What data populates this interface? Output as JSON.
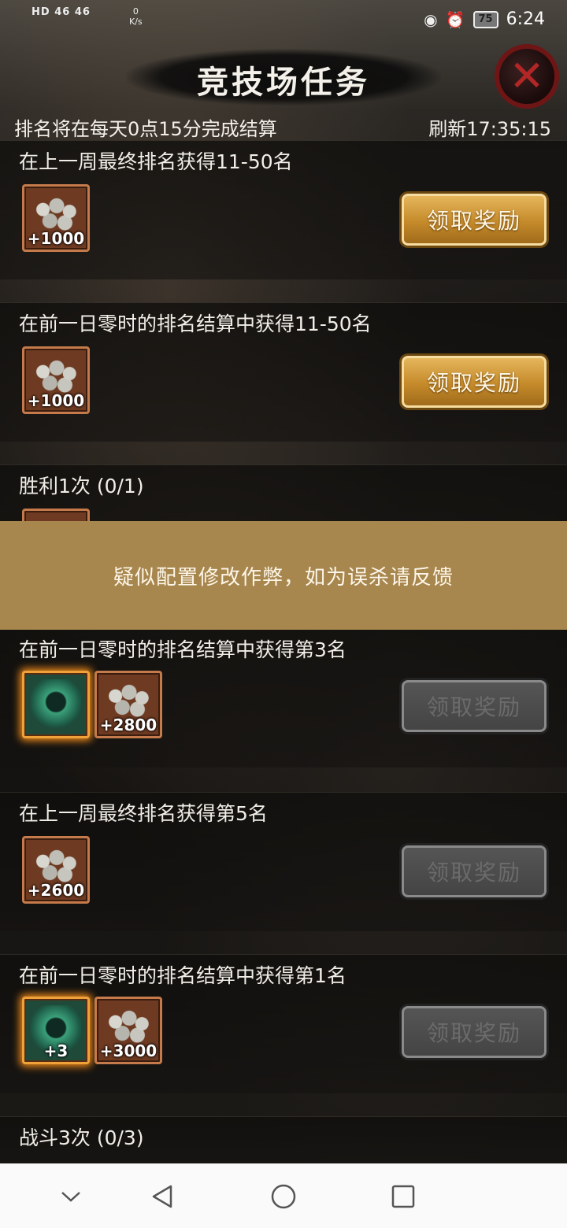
{
  "status_bar": {
    "sim_label": "HD 46 46",
    "net_speed_value": "0",
    "net_speed_unit": "K/s",
    "battery": "75",
    "time": "6:24"
  },
  "header": {
    "title": "竞技场任务",
    "settle_notice": "排名将在每天0点15分完成结算",
    "refresh": "刷新17:35:15"
  },
  "tasks": [
    {
      "title": "在上一周最终排名获得11-50名",
      "rewards": [
        {
          "type": "coins",
          "qty": "+1000"
        }
      ],
      "button": "领取奖励",
      "state": "active"
    },
    {
      "title": "在前一日零时的排名结算中获得11-50名",
      "rewards": [
        {
          "type": "coins",
          "qty": "+1000"
        }
      ],
      "button": "领取奖励",
      "state": "active"
    },
    {
      "title": "胜利1次 (0/1)",
      "rewards": [],
      "button": "",
      "state": "hidden"
    },
    {
      "title": "在前一日零时的排名结算中获得第3名",
      "rewards": [
        {
          "type": "hero",
          "qty": ""
        },
        {
          "type": "coins",
          "qty": "+2800"
        }
      ],
      "button": "领取奖励",
      "state": "disabled"
    },
    {
      "title": "在上一周最终排名获得第5名",
      "rewards": [
        {
          "type": "coins",
          "qty": "+2600"
        }
      ],
      "button": "领取奖励",
      "state": "disabled"
    },
    {
      "title": "在前一日零时的排名结算中获得第1名",
      "rewards": [
        {
          "type": "hero",
          "qty": "+3"
        },
        {
          "type": "coins",
          "qty": "+3000"
        }
      ],
      "button": "领取奖励",
      "state": "disabled"
    },
    {
      "title": "战斗3次 (0/3)",
      "rewards": [],
      "button": "",
      "state": "hidden"
    }
  ],
  "toast": "疑似配置修改作弊，如为误杀请反馈",
  "nav": {
    "icons": [
      "chevron-down-icon",
      "back-icon",
      "home-icon",
      "recents-icon"
    ]
  },
  "colors": {
    "toast_bg": "#a8874f",
    "button_gold": "#c58a2a",
    "button_disabled": "#4a4a4a",
    "close_red": "#b32626"
  }
}
